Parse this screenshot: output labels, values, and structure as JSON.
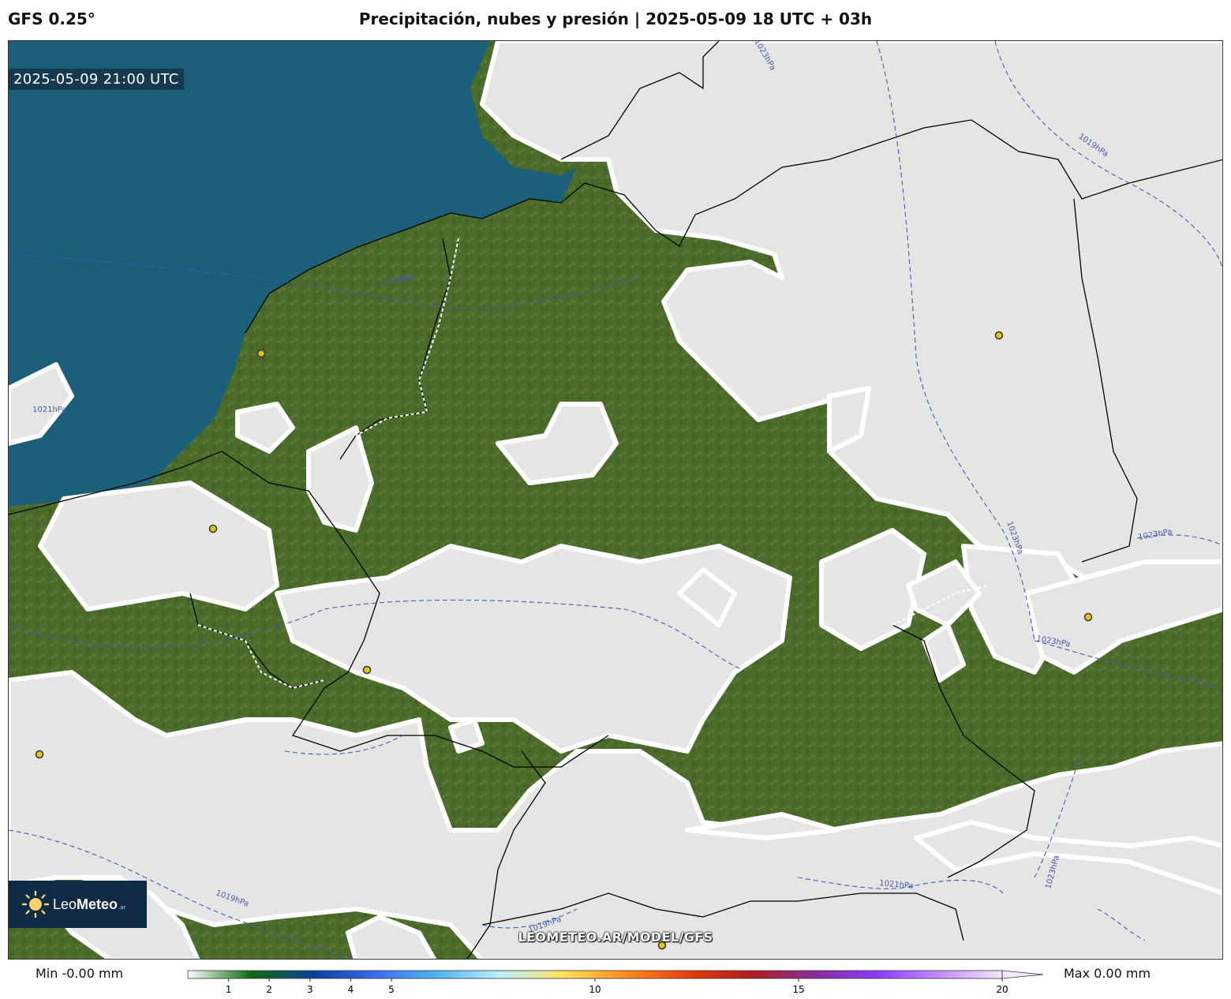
{
  "header": {
    "model": "GFS 0.25°",
    "title": "Precipitación, nubes y presión | 2025-05-09 18 UTC + 03h"
  },
  "map": {
    "valid_time": "2025-05-09 21:00 UTC",
    "watermark": "LEOMETEO.AR/MODEL/GFS",
    "isobar_labels": [
      "1019hPa",
      "1023hPa",
      "1023hPa",
      "1023hPa",
      "1023hPa",
      "1023hPa",
      "1021hPa",
      "1023hPa",
      "1019hPa",
      "1019hPa",
      "1021hPa"
    ],
    "colors": {
      "sea": "#1b5f78",
      "land": "#4a6a2a",
      "cloud": "#e3e6e2",
      "isobar": "#4a56b8"
    }
  },
  "logo": {
    "name_light": "Leo",
    "name_bold": "Meteo",
    "suffix": ".ar"
  },
  "legend": {
    "min_label": "Min -0.00 mm",
    "max_label": "Max 0.00 mm",
    "ticks": [
      "1",
      "2",
      "3",
      "4",
      "5",
      "10",
      "15",
      "20"
    ],
    "tick_values": [
      1,
      2,
      3,
      4,
      5,
      10,
      15,
      20
    ],
    "range": [
      0,
      20
    ],
    "gradient": [
      "#ffffff",
      "#0f6b12",
      "#0b3f9a",
      "#3a6df0",
      "#4fb7f0",
      "#bff0ff",
      "#ffe15a",
      "#ff8a1e",
      "#e63c0e",
      "#b01e1e",
      "#8a2b9a",
      "#8c3cff",
      "#c68cff",
      "#f3e6ff"
    ]
  }
}
